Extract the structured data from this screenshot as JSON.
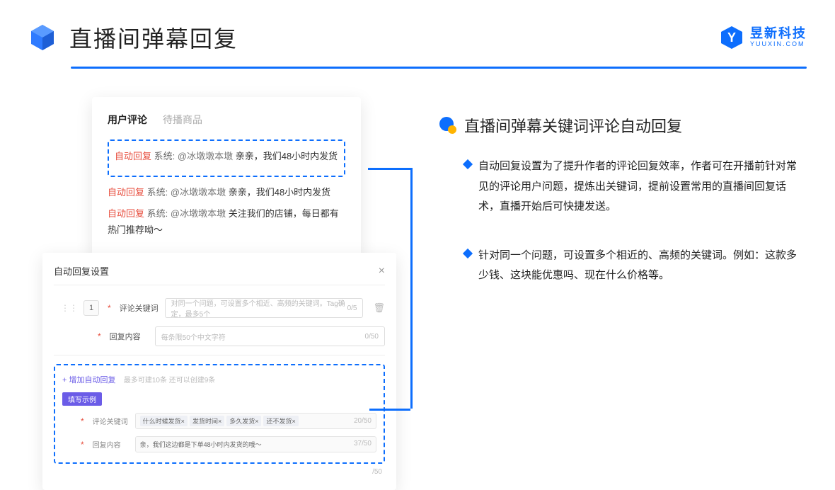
{
  "header": {
    "title": "直播间弹幕回复",
    "brand_cn": "昱新科技",
    "brand_en": "YUUXIN.COM"
  },
  "comments_panel": {
    "tab_active": "用户评论",
    "tab_inactive": "待播商品",
    "highlighted": {
      "flag": "自动回复",
      "sys": "系统:",
      "mention": "@冰墩墩本墩",
      "text": "亲亲，我们48小时内发货"
    },
    "lines": [
      {
        "flag": "自动回复",
        "sys": "系统:",
        "mention": "@冰墩墩本墩",
        "text": "亲亲，我们48小时内发货"
      },
      {
        "flag": "自动回复",
        "sys": "系统:",
        "mention": "@冰墩墩本墩",
        "text": "关注我们的店铺，每日都有热门推荐呦～"
      }
    ]
  },
  "settings_panel": {
    "title": "自动回复设置",
    "row_num": "1",
    "keyword_label": "评论关键词",
    "keyword_placeholder": "对同一个问题，可设置多个相近、高频的关键词。Tag确定，最多5个",
    "keyword_count": "0/5",
    "content_label": "回复内容",
    "content_placeholder": "每条限50个中文字符",
    "content_count": "0/50",
    "add_link": "+ 增加自动回复",
    "add_hint": "最多可建10条 还可以创建9条",
    "badge": "填写示例",
    "ex_keyword_label": "评论关键词",
    "ex_tags": [
      "什么时候发货×",
      "发货时间×",
      "多久发货×",
      "还不发货×"
    ],
    "ex_keyword_count": "20/50",
    "ex_content_label": "回复内容",
    "ex_content_text": "亲，我们这边都是下单48小时内发货的哦～",
    "ex_content_count": "37/50",
    "outer_count": "/50"
  },
  "right": {
    "title": "直播间弹幕关键词评论自动回复",
    "bullets": [
      "自动回复设置为了提升作者的评论回复效率，作者可在开播前针对常见的评论用户问题，提炼出关键词，提前设置常用的直播间回复话术，直播开始后可快捷发送。",
      "针对同一个问题，可设置多个相近的、高频的关键词。例如：这款多少钱、这块能优惠吗、现在什么价格等。"
    ]
  }
}
